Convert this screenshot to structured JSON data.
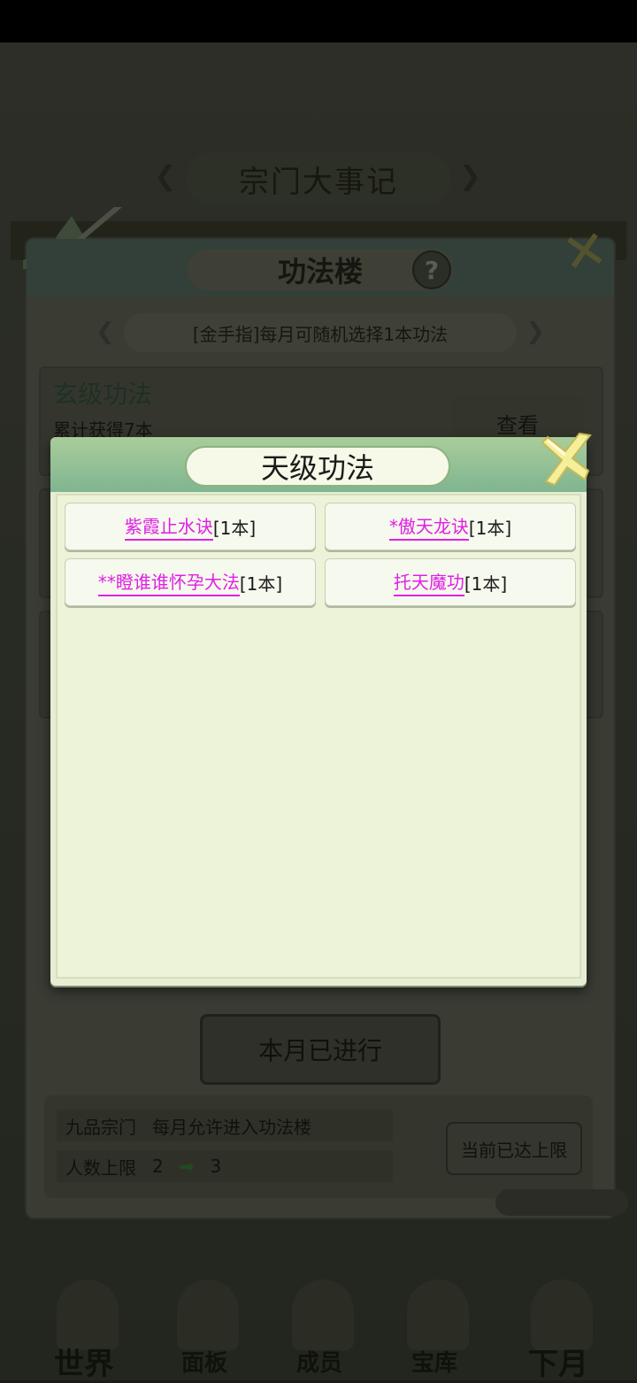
{
  "background": {
    "events_banner": "宗门大事记",
    "hall": {
      "title": "功法楼",
      "help": "?",
      "cheat_text": "[金手指]每月可随机选择1本功法",
      "ranks": [
        {
          "title": "玄级功法",
          "count_text": "累计获得7本",
          "view_label": "查看"
        }
      ],
      "done_button": "本月已进行",
      "info": {
        "sect_level": "九品宗门",
        "permission": "每月允许进入功法楼",
        "member_label": "人数上限",
        "member_from": "2",
        "member_to": "3",
        "limit_button": "当前已达上限"
      }
    },
    "bottom_nav": [
      "世界",
      "面板",
      "成员",
      "宝库",
      "下月"
    ]
  },
  "modal": {
    "title": "天级功法",
    "techniques": [
      {
        "name": "紫霞止水诀",
        "count": "[1本]"
      },
      {
        "name": "*傲天龙诀",
        "count": "[1本]"
      },
      {
        "name": "**瞪谁谁怀孕大法",
        "count": "[1本]"
      },
      {
        "name": "托天魔功",
        "count": "[1本]"
      }
    ]
  },
  "colors": {
    "technique_name": "#e020e6",
    "modal_header": "#8cbf98",
    "modal_body": "#edf3d8",
    "close_icon": "#f5ef9a"
  }
}
